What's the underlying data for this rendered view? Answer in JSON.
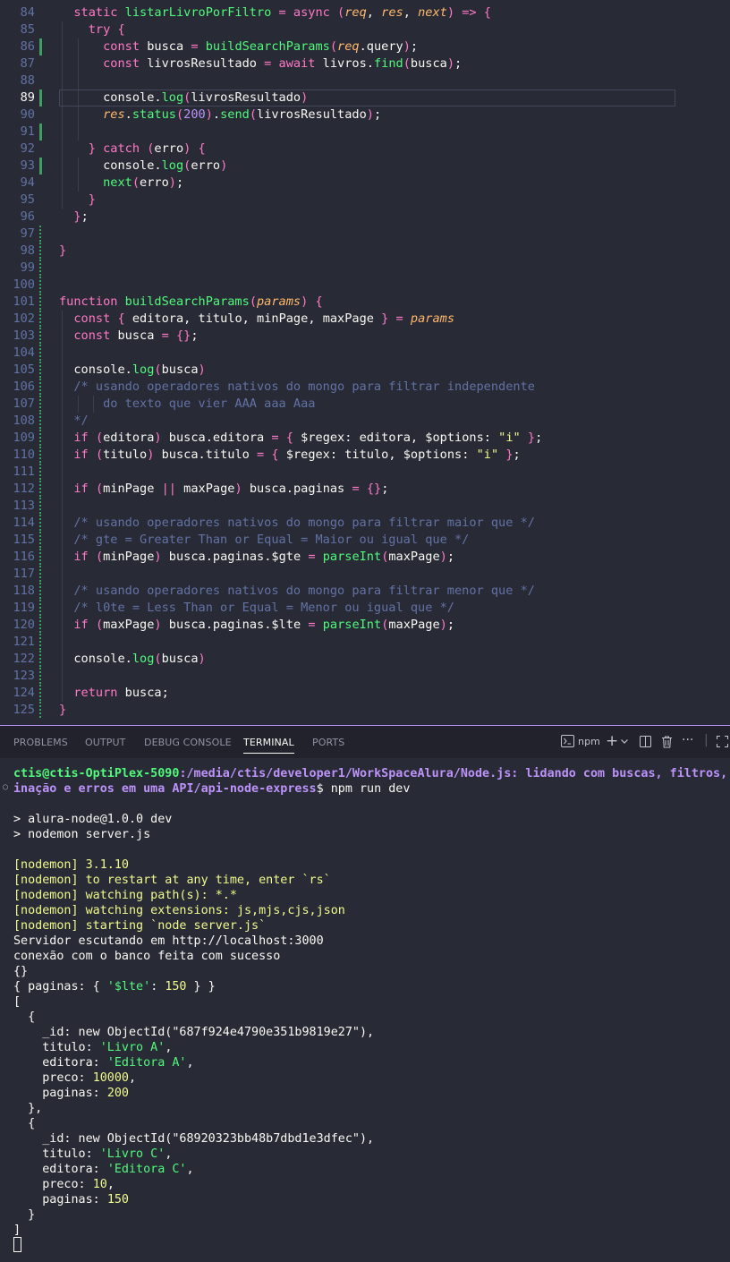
{
  "editor": {
    "current_line": 89,
    "lines": [
      {
        "n": "84",
        "text": "  static listarLivroPorFiltro = async (req, res, next) => {"
      },
      {
        "n": "85",
        "text": "    try {"
      },
      {
        "n": "86",
        "text": "      const busca = buildSearchParams(req.query);"
      },
      {
        "n": "87",
        "text": "      const livrosResultado = await livros.find(busca);"
      },
      {
        "n": "88",
        "text": ""
      },
      {
        "n": "89",
        "text": "      console.log(livrosResultado)"
      },
      {
        "n": "90",
        "text": "      res.status(200).send(livrosResultado);"
      },
      {
        "n": "91",
        "text": ""
      },
      {
        "n": "92",
        "text": "    } catch (erro) {"
      },
      {
        "n": "93",
        "text": "      console.log(erro)"
      },
      {
        "n": "94",
        "text": "      next(erro);"
      },
      {
        "n": "95",
        "text": "    }"
      },
      {
        "n": "96",
        "text": "  };"
      },
      {
        "n": "97",
        "text": ""
      },
      {
        "n": "98",
        "text": "}"
      },
      {
        "n": "99",
        "text": ""
      },
      {
        "n": "100",
        "text": ""
      },
      {
        "n": "101",
        "text": "function buildSearchParams(params) {"
      },
      {
        "n": "102",
        "text": "  const { editora, titulo, minPage, maxPage } = params"
      },
      {
        "n": "103",
        "text": "  const busca = {};"
      },
      {
        "n": "104",
        "text": ""
      },
      {
        "n": "105",
        "text": "  console.log(busca)"
      },
      {
        "n": "106",
        "text": "  /* usando operadores nativos do mongo para filtrar independente"
      },
      {
        "n": "107",
        "text": "      do texto que vier AAA aaa Aaa"
      },
      {
        "n": "108",
        "text": "  */"
      },
      {
        "n": "109",
        "text": "  if (editora) busca.editora = { $regex: editora, $options: \"i\" };"
      },
      {
        "n": "110",
        "text": "  if (titulo) busca.titulo = { $regex: titulo, $options: \"i\" };"
      },
      {
        "n": "111",
        "text": ""
      },
      {
        "n": "112",
        "text": "  if (minPage || maxPage) busca.paginas = {};"
      },
      {
        "n": "113",
        "text": ""
      },
      {
        "n": "114",
        "text": "  /* usando operadores nativos do mongo para filtrar maior que */"
      },
      {
        "n": "115",
        "text": "  /* gte = Greater Than or Equal = Maior ou igual que */"
      },
      {
        "n": "116",
        "text": "  if (minPage) busca.paginas.$gte = parseInt(maxPage);"
      },
      {
        "n": "117",
        "text": ""
      },
      {
        "n": "118",
        "text": "  /* usando operadores nativos do mongo para filtrar menor que */"
      },
      {
        "n": "119",
        "text": "  /* l0te = Less Than or Equal = Menor ou igual que */"
      },
      {
        "n": "120",
        "text": "  if (maxPage) busca.paginas.$lte = parseInt(maxPage);"
      },
      {
        "n": "121",
        "text": ""
      },
      {
        "n": "122",
        "text": "  console.log(busca)"
      },
      {
        "n": "123",
        "text": ""
      },
      {
        "n": "124",
        "text": "  return busca;"
      },
      {
        "n": "125",
        "text": "}"
      }
    ]
  },
  "panel": {
    "tabs": [
      "PROBLEMS",
      "OUTPUT",
      "DEBUG CONSOLE",
      "TERMINAL",
      "PORTS"
    ],
    "active_tab": "TERMINAL",
    "terminal_name": "npm",
    "icons": [
      "terminal-icon",
      "plus-icon",
      "chevron-down-icon",
      "split-icon",
      "trash-icon",
      "more-icon",
      "maximize-icon"
    ]
  },
  "terminal": {
    "prompt_user": "ctis@ctis-OptiPlex-5090",
    "prompt_path_1": ":/media/ctis/developer1/WorkSpaceAlura/Node.js: lidando com buscas, filtros,",
    "prompt_path_2": "inação e erros em uma API/api-node-express",
    "prompt_cmd": "$ npm run dev",
    "lines": [
      "",
      "> alura-node@1.0.0 dev",
      "> nodemon server.js",
      "",
      "[nodemon] 3.1.10",
      "[nodemon] to restart at any time, enter `rs`",
      "[nodemon] watching path(s): *.*",
      "[nodemon] watching extensions: js,mjs,cjs,json",
      "[nodemon] starting `node server.js`",
      "Servidor escutando em http://localhost:3000",
      "conexão com o banco feita com sucesso",
      "{}",
      "{ paginas: { '$lte': 150 } }",
      "[",
      "  {",
      "    _id: new ObjectId(\"687f924e4790e351b9819e27\"),",
      "    titulo: 'Livro A',",
      "    editora: 'Editora A',",
      "    preco: 10000,",
      "    paginas: 200",
      "  },",
      "  {",
      "    _id: new ObjectId(\"68920323bb48b7dbd1e3dfec\"),",
      "    titulo: 'Livro C',",
      "    editora: 'Editora C',",
      "    preco: 10,",
      "    paginas: 150",
      "  }",
      "]"
    ]
  },
  "colors": {
    "editor_bg": "#282a36",
    "keyword": "#ff79c6",
    "function": "#50fa7b",
    "string": "#f1fa8c",
    "comment": "#6272a4",
    "param": "#ffb86c",
    "accent": "#bd93f9"
  }
}
